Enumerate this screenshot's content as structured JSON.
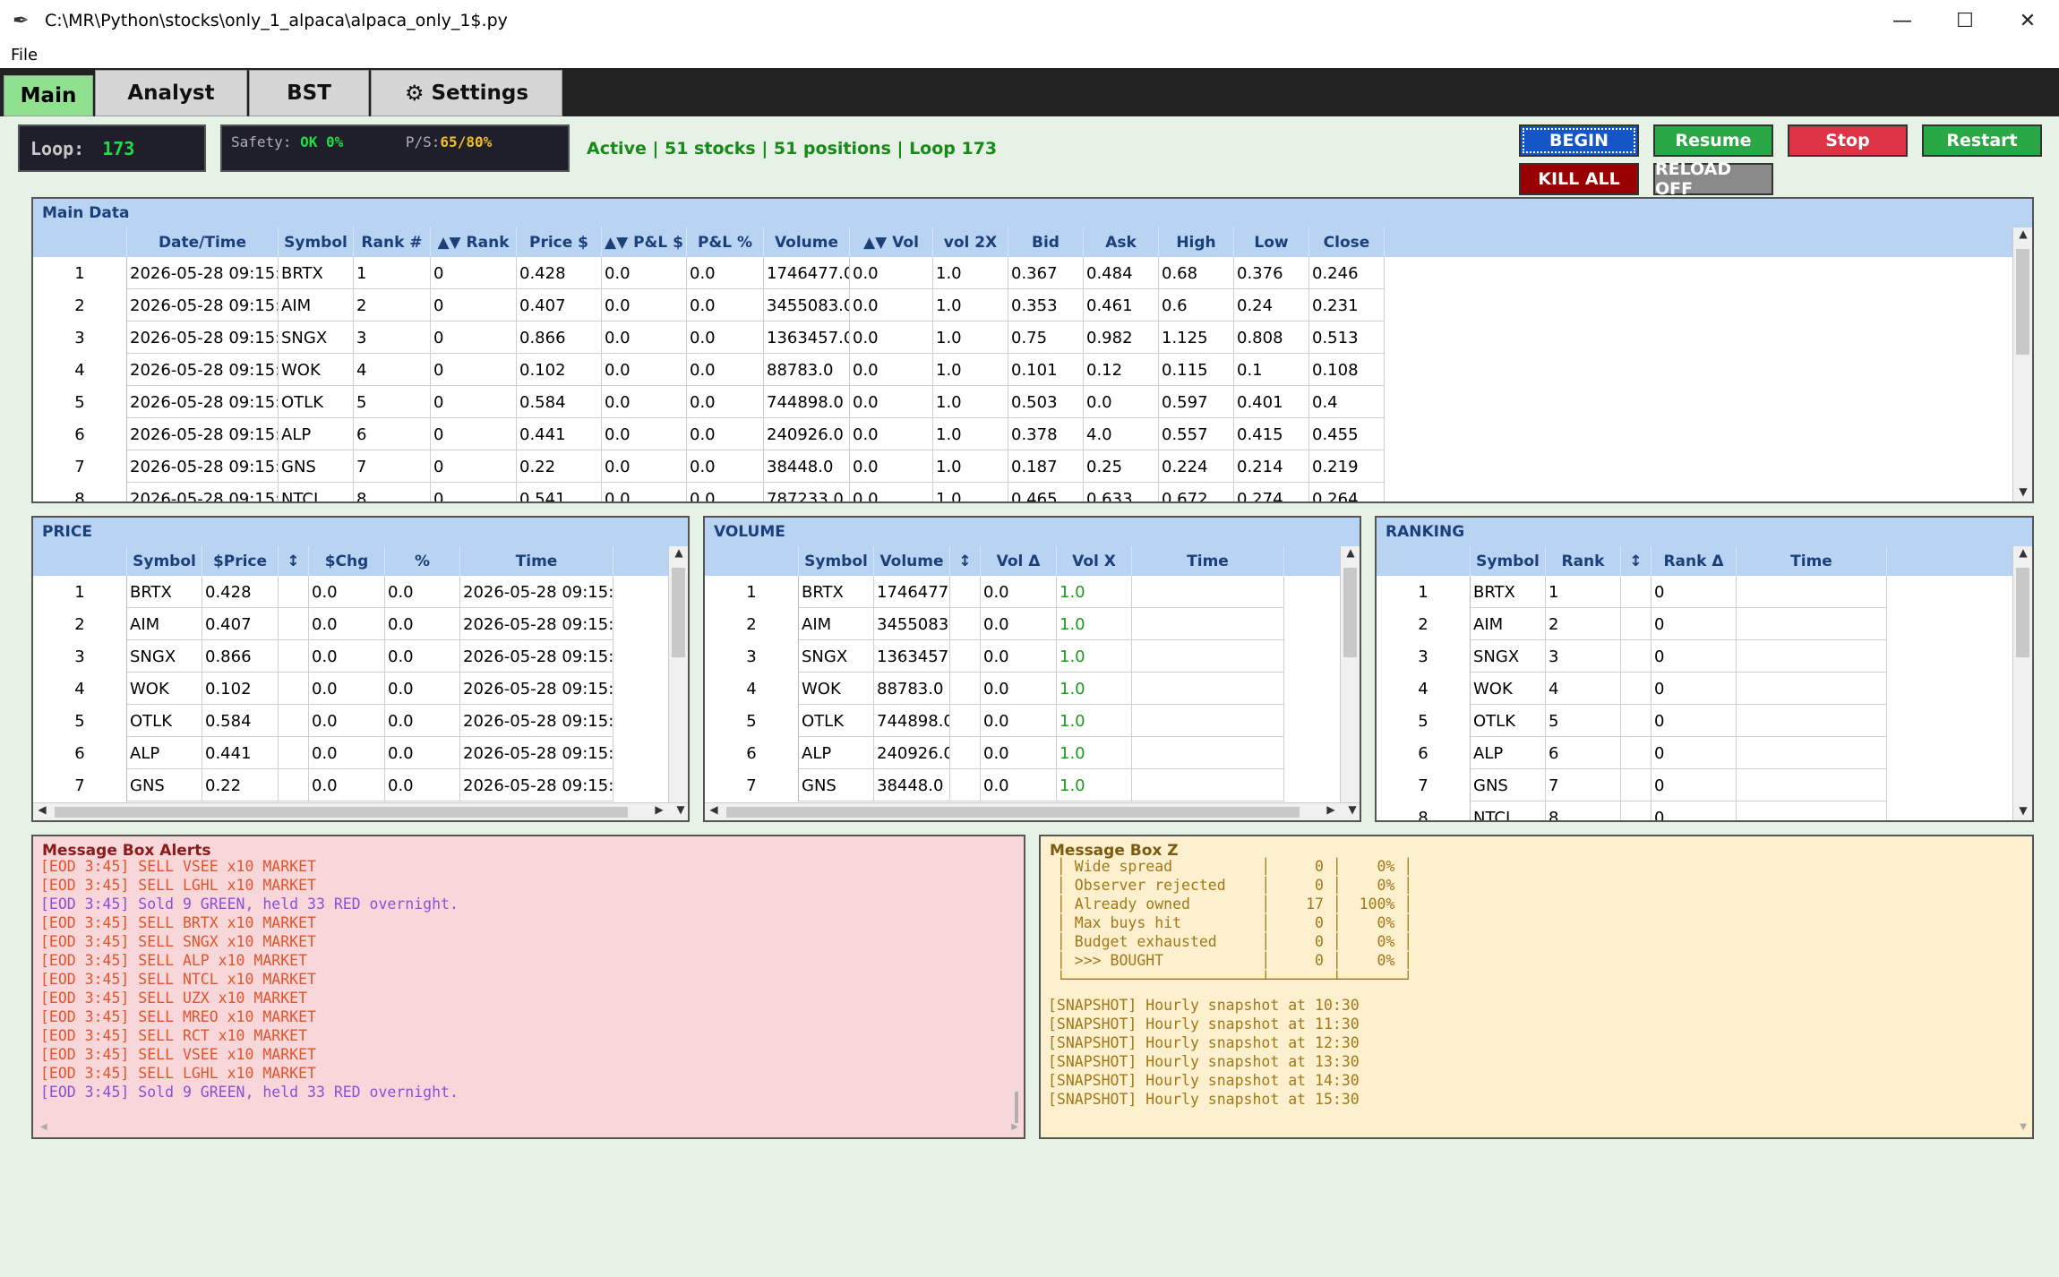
{
  "window": {
    "title": "C:\\MR\\Python\\stocks\\only_1_alpaca\\alpaca_only_1$.py",
    "minimize": "—",
    "maximize": "☐",
    "close": "✕"
  },
  "menu": {
    "file": "File"
  },
  "tabs": {
    "main": "Main",
    "analyst": "Analyst",
    "bst": "BST",
    "settings": "Settings"
  },
  "status": {
    "loop_label": "Loop:",
    "loop_value": "173",
    "safety_label": "Safety:",
    "safety_value": "OK 0%",
    "ps_label": "P/S:",
    "ps_value": "65/80%",
    "summary": "Active | 51 stocks | 51 positions | Loop 173"
  },
  "controls": {
    "begin": "BEGIN",
    "resume": "Resume",
    "stop": "Stop",
    "restart": "Restart",
    "kill_all": "KILL ALL",
    "reload": "RELOAD OFF"
  },
  "colors": {
    "begin": "#1455c8",
    "resume": "#2aa845",
    "stop": "#dd3344",
    "restart": "#2aa845",
    "kill_all": "#990000",
    "reload": "#8a8a8a"
  },
  "main_data": {
    "title": "Main Data",
    "columns": [
      "Date/Time",
      "Symbol",
      "Rank #",
      "▲▼ Rank",
      "Price $",
      "▲▼ P&L $",
      "P&L %",
      "Volume",
      "▲▼ Vol",
      "vol 2X",
      "Bid",
      "Ask",
      "High",
      "Low",
      "Close"
    ],
    "rows": [
      {
        "n": "1",
        "cells": [
          "2026-05-28 09:15:",
          "BRTX",
          "1",
          "0",
          "0.428",
          "0.0",
          "0.0",
          "1746477.0",
          "0.0",
          "1.0",
          "0.367",
          "0.484",
          "0.68",
          "0.376",
          "0.246"
        ]
      },
      {
        "n": "2",
        "cells": [
          "2026-05-28 09:15:",
          "AIM",
          "2",
          "0",
          "0.407",
          "0.0",
          "0.0",
          "3455083.0",
          "0.0",
          "1.0",
          "0.353",
          "0.461",
          "0.6",
          "0.24",
          "0.231"
        ]
      },
      {
        "n": "3",
        "cells": [
          "2026-05-28 09:15:",
          "SNGX",
          "3",
          "0",
          "0.866",
          "0.0",
          "0.0",
          "1363457.0",
          "0.0",
          "1.0",
          "0.75",
          "0.982",
          "1.125",
          "0.808",
          "0.513"
        ]
      },
      {
        "n": "4",
        "cells": [
          "2026-05-28 09:15:",
          "WOK",
          "4",
          "0",
          "0.102",
          "0.0",
          "0.0",
          "88783.0",
          "0.0",
          "1.0",
          "0.101",
          "0.12",
          "0.115",
          "0.1",
          "0.108"
        ]
      },
      {
        "n": "5",
        "cells": [
          "2026-05-28 09:15:",
          "OTLK",
          "5",
          "0",
          "0.584",
          "0.0",
          "0.0",
          "744898.0",
          "0.0",
          "1.0",
          "0.503",
          "0.0",
          "0.597",
          "0.401",
          "0.4"
        ]
      },
      {
        "n": "6",
        "cells": [
          "2026-05-28 09:15:",
          "ALP",
          "6",
          "0",
          "0.441",
          "0.0",
          "0.0",
          "240926.0",
          "0.0",
          "1.0",
          "0.378",
          "4.0",
          "0.557",
          "0.415",
          "0.455"
        ]
      },
      {
        "n": "7",
        "cells": [
          "2026-05-28 09:15:",
          "GNS",
          "7",
          "0",
          "0.22",
          "0.0",
          "0.0",
          "38448.0",
          "0.0",
          "1.0",
          "0.187",
          "0.25",
          "0.224",
          "0.214",
          "0.219"
        ]
      },
      {
        "n": "8",
        "cells": [
          "2026-05-28 09:15:",
          "NTCL",
          "8",
          "0",
          "0.541",
          "0.0",
          "0.0",
          "787233.0",
          "0.0",
          "1.0",
          "0.465",
          "0.633",
          "0.672",
          "0.274",
          "0.264"
        ]
      }
    ]
  },
  "price": {
    "title": "PRICE",
    "columns": [
      "Symbol",
      "$Price",
      "↕",
      "$Chg",
      "%",
      "Time"
    ],
    "rows": [
      {
        "n": "1",
        "cells": [
          "BRTX",
          "0.428",
          "",
          "0.0",
          "0.0",
          "2026-05-28 09:15:"
        ]
      },
      {
        "n": "2",
        "cells": [
          "AIM",
          "0.407",
          "",
          "0.0",
          "0.0",
          "2026-05-28 09:15:"
        ]
      },
      {
        "n": "3",
        "cells": [
          "SNGX",
          "0.866",
          "",
          "0.0",
          "0.0",
          "2026-05-28 09:15:"
        ]
      },
      {
        "n": "4",
        "cells": [
          "WOK",
          "0.102",
          "",
          "0.0",
          "0.0",
          "2026-05-28 09:15:"
        ]
      },
      {
        "n": "5",
        "cells": [
          "OTLK",
          "0.584",
          "",
          "0.0",
          "0.0",
          "2026-05-28 09:15:"
        ]
      },
      {
        "n": "6",
        "cells": [
          "ALP",
          "0.441",
          "",
          "0.0",
          "0.0",
          "2026-05-28 09:15:"
        ]
      },
      {
        "n": "7",
        "cells": [
          "GNS",
          "0.22",
          "",
          "0.0",
          "0.0",
          "2026-05-28 09:15:"
        ]
      }
    ]
  },
  "volume": {
    "title": "VOLUME",
    "columns": [
      "Symbol",
      "Volume",
      "↕",
      "Vol Δ",
      "Vol X",
      "Time"
    ],
    "rows": [
      {
        "n": "1",
        "cells": [
          "BRTX",
          "1746477.0",
          "",
          "0.0",
          "1.0",
          ""
        ]
      },
      {
        "n": "2",
        "cells": [
          "AIM",
          "3455083.0",
          "",
          "0.0",
          "1.0",
          ""
        ]
      },
      {
        "n": "3",
        "cells": [
          "SNGX",
          "1363457.0",
          "",
          "0.0",
          "1.0",
          ""
        ]
      },
      {
        "n": "4",
        "cells": [
          "WOK",
          "88783.0",
          "",
          "0.0",
          "1.0",
          ""
        ]
      },
      {
        "n": "5",
        "cells": [
          "OTLK",
          "744898.0",
          "",
          "0.0",
          "1.0",
          ""
        ]
      },
      {
        "n": "6",
        "cells": [
          "ALP",
          "240926.0",
          "",
          "0.0",
          "1.0",
          ""
        ]
      },
      {
        "n": "7",
        "cells": [
          "GNS",
          "38448.0",
          "",
          "0.0",
          "1.0",
          ""
        ]
      }
    ]
  },
  "ranking": {
    "title": "RANKING",
    "columns": [
      "Symbol",
      "Rank",
      "↕",
      "Rank Δ",
      "Time"
    ],
    "rows": [
      {
        "n": "1",
        "cells": [
          "BRTX",
          "1",
          "",
          "0",
          ""
        ]
      },
      {
        "n": "2",
        "cells": [
          "AIM",
          "2",
          "",
          "0",
          ""
        ]
      },
      {
        "n": "3",
        "cells": [
          "SNGX",
          "3",
          "",
          "0",
          ""
        ]
      },
      {
        "n": "4",
        "cells": [
          "WOK",
          "4",
          "",
          "0",
          ""
        ]
      },
      {
        "n": "5",
        "cells": [
          "OTLK",
          "5",
          "",
          "0",
          ""
        ]
      },
      {
        "n": "6",
        "cells": [
          "ALP",
          "6",
          "",
          "0",
          ""
        ]
      },
      {
        "n": "7",
        "cells": [
          "GNS",
          "7",
          "",
          "0",
          ""
        ]
      },
      {
        "n": "8",
        "cells": [
          "NTCL",
          "8",
          "",
          "0",
          ""
        ]
      }
    ]
  },
  "alerts": {
    "title": "Message Box Alerts",
    "lines": [
      {
        "text": "[EOD 3:45] SELL VSEE x10 MARKET",
        "kind": "sell"
      },
      {
        "text": "[EOD 3:45] SELL LGHL x10 MARKET",
        "kind": "sell"
      },
      {
        "text": "[EOD 3:45] Sold 9 GREEN, held 33 RED overnight.",
        "kind": "summary"
      },
      {
        "text": "[EOD 3:45] SELL BRTX x10 MARKET",
        "kind": "sell"
      },
      {
        "text": "[EOD 3:45] SELL SNGX x10 MARKET",
        "kind": "sell"
      },
      {
        "text": "[EOD 3:45] SELL ALP x10 MARKET",
        "kind": "sell"
      },
      {
        "text": "[EOD 3:45] SELL NTCL x10 MARKET",
        "kind": "sell"
      },
      {
        "text": "[EOD 3:45] SELL UZX x10 MARKET",
        "kind": "sell"
      },
      {
        "text": "[EOD 3:45] SELL MREO x10 MARKET",
        "kind": "sell"
      },
      {
        "text": "[EOD 3:45] SELL RCT x10 MARKET",
        "kind": "sell"
      },
      {
        "text": "[EOD 3:45] SELL VSEE x10 MARKET",
        "kind": "sell"
      },
      {
        "text": "[EOD 3:45] SELL LGHL x10 MARKET",
        "kind": "sell"
      },
      {
        "text": "[EOD 3:45] Sold 9 GREEN, held 33 RED overnight.",
        "kind": "summary"
      }
    ]
  },
  "msgz": {
    "title": "Message Box Z",
    "lines": [
      " │ Wide spread          │     0 │    0% │",
      " │ Observer rejected    │     0 │    0% │",
      " │ Already owned        │    17 │  100% │",
      " │ Max buys hit         │     0 │    0% │",
      " │ Budget exhausted     │     0 │    0% │",
      " │ >>> BOUGHT           │     0 │    0% │",
      " └──────────────────────┴───────┴───────┘",
      "[SNAPSHOT] Hourly snapshot at 10:30",
      "[SNAPSHOT] Hourly snapshot at 11:30",
      "[SNAPSHOT] Hourly snapshot at 12:30",
      "[SNAPSHOT] Hourly snapshot at 13:30",
      "[SNAPSHOT] Hourly snapshot at 14:30",
      "[SNAPSHOT] Hourly snapshot at 15:30"
    ]
  }
}
